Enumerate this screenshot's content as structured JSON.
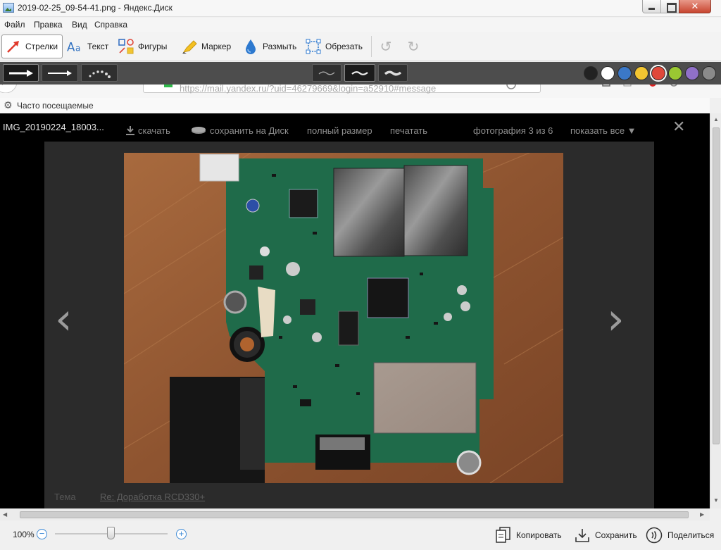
{
  "window": {
    "title": "2019-02-25_09-54-41.png - Яндекс.Диск"
  },
  "menu": {
    "items": [
      {
        "label": "Файл"
      },
      {
        "label": "Правка"
      },
      {
        "label": "Вид"
      },
      {
        "label": "Справка"
      }
    ]
  },
  "toolbar": {
    "tools": [
      {
        "label": "Стрелки",
        "icon": "arrow-tool-icon",
        "active": true
      },
      {
        "label": "Текст",
        "icon": "text-tool-icon"
      },
      {
        "label": "Фигуры",
        "icon": "shapes-tool-icon"
      },
      {
        "label": "Маркер",
        "icon": "marker-tool-icon"
      },
      {
        "label": "Размыть",
        "icon": "blur-tool-icon"
      },
      {
        "label": "Обрезать",
        "icon": "crop-tool-icon"
      }
    ],
    "undo_icon": "undo-icon",
    "redo_icon": "redo-icon"
  },
  "options": {
    "arrow_styles": [
      "arrow-thick",
      "arrow-thin",
      "arrow-dotted"
    ],
    "selected_arrow_style": 0,
    "line_styles": [
      "wave-thin",
      "wave-medium",
      "wave-thick"
    ],
    "selected_line_style": 1,
    "colors": [
      "#222222",
      "#ffffff",
      "#3b78c8",
      "#f2c531",
      "#e0483a",
      "#9ac832",
      "#9070c8",
      "#8a8a8a"
    ],
    "selected_color": 4
  },
  "browser": {
    "url": "https://mail.yandex.ru/?uid=46279669&login=a52910#message",
    "bookmarks_label": "Часто посещаемые"
  },
  "viewer": {
    "filename": "IMG_20190224_18003...",
    "download": "скачать",
    "save_to_disk": "сохранить на Диск",
    "full_size": "полный размер",
    "print": "печатать",
    "counter": "фотография 3 из 6",
    "show_all": "показать все ▼",
    "close_icon": "close-icon",
    "theme_label": "Тема",
    "theme_link": "Re: Доработка RCD330+"
  },
  "statusbar": {
    "zoom": "100%",
    "zoom_level": 0.5,
    "copy": "Копировать",
    "save": "Сохранить",
    "share": "Поделиться"
  }
}
